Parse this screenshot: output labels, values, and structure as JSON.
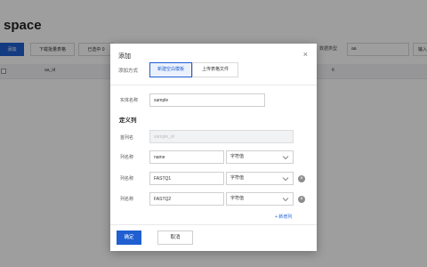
{
  "page": {
    "title": "space",
    "toolbar": {
      "add_label": "添加",
      "download_template_label": "下载批量表格",
      "import_label": "已选中 0",
      "datatype_label": "数据类型",
      "select_value": "aa",
      "right_button_label": "输入"
    },
    "table": {
      "headers": [
        "aa_id",
        "tt"
      ]
    }
  },
  "modal": {
    "title": "添加",
    "close_glyph": "×",
    "method_label": "添加方式",
    "method_options": [
      {
        "label": "新建空白模板",
        "active": true
      },
      {
        "label": "上传表格文件",
        "active": false
      }
    ],
    "entity_name_label": "实体名称",
    "entity_name_value": "sample",
    "section_title": "定义列",
    "id_column_label": "首列名",
    "id_column_placeholder": "sample_id",
    "columns": [
      {
        "label": "列名称",
        "name": "name",
        "type": "字符值",
        "removable": false
      },
      {
        "label": "列名称",
        "name": "FASTQ1",
        "type": "字符值",
        "removable": true
      },
      {
        "label": "列名称",
        "name": "FASTQ2",
        "type": "字符值",
        "removable": true
      }
    ],
    "add_column_label": "+ 新增列",
    "confirm_label": "确定",
    "cancel_label": "取消"
  }
}
